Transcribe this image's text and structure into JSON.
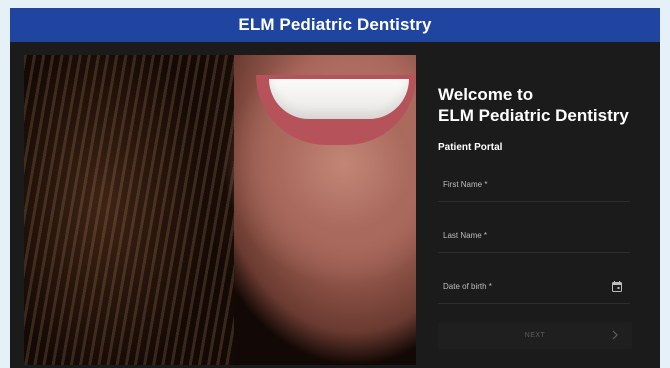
{
  "header": {
    "title": "ELM Pediatric Dentistry"
  },
  "welcome": {
    "line1": "Welcome to",
    "line2": "ELM Pediatric Dentistry"
  },
  "portal": {
    "label": "Patient Portal"
  },
  "form": {
    "first_name_label": "First Name *",
    "last_name_label": "Last Name *",
    "dob_label": "Date of birth *",
    "next_label": "NEXT"
  },
  "icons": {
    "calendar": "calendar-icon",
    "chevron": "chevron-right-icon"
  },
  "colors": {
    "header": "#1f45a0",
    "background": "#1b1b1b",
    "page": "#e6f1f7"
  }
}
